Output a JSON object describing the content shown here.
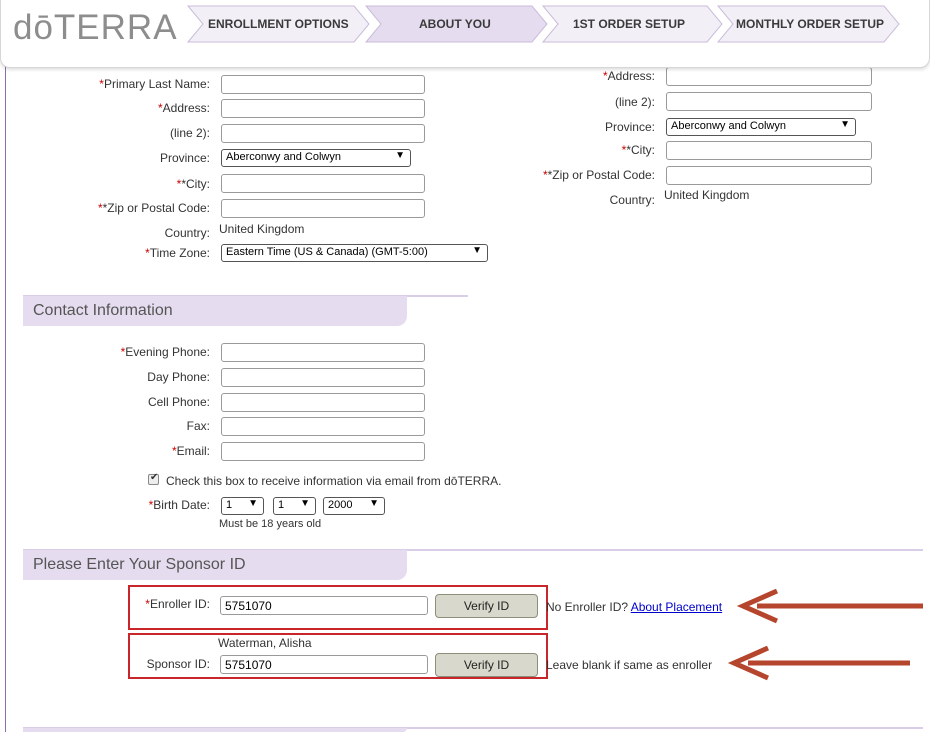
{
  "header": {
    "logo": "dōTERRA",
    "steps": [
      {
        "label": "ENROLLMENT OPTIONS"
      },
      {
        "label": "ABOUT YOU"
      },
      {
        "label": "1ST ORDER SETUP"
      },
      {
        "label": "MONTHLY ORDER SETUP"
      }
    ]
  },
  "address_left": {
    "last_name_label": "Primary Last Name:",
    "address_label": "Address:",
    "line2_label": "(line 2):",
    "province_label": "Province:",
    "province_value": "Aberconwy and Colwyn",
    "city_label": "*City:",
    "zip_label": "*Zip or Postal Code:",
    "country_label": "Country:",
    "country_value": "United Kingdom",
    "timezone_label": "Time Zone:",
    "timezone_value": "Eastern Time (US & Canada) (GMT-5:00)"
  },
  "address_right": {
    "address_label": "Address:",
    "line2_label": "(line 2):",
    "province_label": "Province:",
    "province_value": "Aberconwy and Colwyn",
    "city_label": "*City:",
    "zip_label": "*Zip or Postal Code:",
    "country_label": "Country:",
    "country_value": "United Kingdom"
  },
  "contact": {
    "title": "Contact Information",
    "evening_phone_label": "Evening Phone:",
    "day_phone_label": "Day Phone:",
    "cell_phone_label": "Cell Phone:",
    "fax_label": "Fax:",
    "email_label": "Email:",
    "email_opt_in": "Check this box to receive information via email from dōTERRA.",
    "birth_label": "Birth Date:",
    "birth_day": "1",
    "birth_month": "1",
    "birth_year": "2000",
    "birth_note": "Must be 18 years old"
  },
  "sponsor": {
    "title": "Please Enter Your Sponsor ID",
    "enroller_label": "Enroller ID:",
    "enroller_value": "5751070",
    "verify_label": "Verify ID",
    "no_enroller_text": "No Enroller ID?",
    "placement_link": "About Placement",
    "sponsor_name": "Waterman, Alisha",
    "sponsor_label": "Sponsor ID:",
    "sponsor_value": "5751070",
    "blank_note": "Leave blank if same as enroller"
  },
  "required_mark": "*",
  "icons": {
    "dropdown": "chevron-down-icon",
    "checkbox": "checkbox-checked-icon",
    "annotation": "red-arrow-icon"
  },
  "colors": {
    "accent": "#e5dcef",
    "highlight": "#c9262c",
    "link": "#0000cc"
  }
}
